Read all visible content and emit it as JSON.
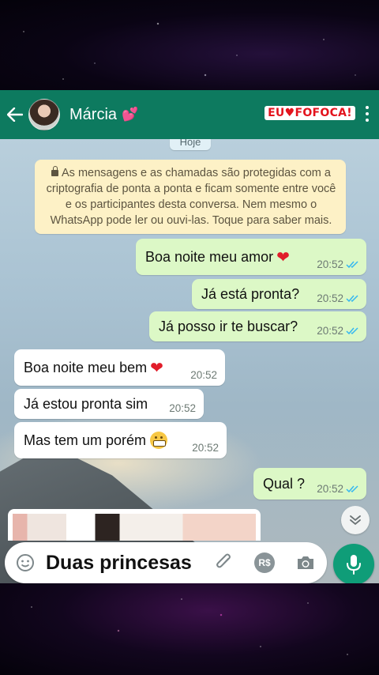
{
  "header": {
    "contact_name": "Márcia",
    "name_emoji": "💕",
    "brand_watermark": {
      "prefix": "EU",
      "heart": "♥",
      "suffix": "FOFOCA!"
    },
    "icons": [
      "back-arrow-icon",
      "menu-dots-icon"
    ]
  },
  "chat": {
    "date_divider": "Hoje",
    "encryption_notice": "As mensagens e as chamadas são protegidas com a criptografia de ponta a ponta e ficam somente entre você e os participantes desta conversa. Nem mesmo o WhatsApp pode ler ou ouvi-las. Toque para saber mais.",
    "messages": [
      {
        "direction": "out",
        "text": "Boa noite meu amor",
        "emoji": "❤",
        "time": "20:52",
        "read": true
      },
      {
        "direction": "out",
        "text": "Já está pronta?",
        "emoji": "",
        "time": "20:52",
        "read": true
      },
      {
        "direction": "out",
        "text": "Já posso ir te buscar?",
        "emoji": "",
        "time": "20:52",
        "read": true
      },
      {
        "direction": "in",
        "text": "Boa noite meu bem",
        "emoji": "❤",
        "time": "20:52"
      },
      {
        "direction": "in",
        "text": "Já estou pronta sim",
        "emoji": "",
        "time": "20:52"
      },
      {
        "direction": "in",
        "text": "Mas tem um porém",
        "emoji": "grimacing-face",
        "time": "20:52"
      },
      {
        "direction": "out",
        "text": "Qual ?",
        "emoji": "",
        "time": "20:52",
        "read": true
      }
    ]
  },
  "composer": {
    "text": "Duas princesas",
    "payment_label": "R$",
    "icons": [
      "emoji-icon",
      "attach-icon",
      "payment-icon",
      "camera-icon",
      "mic-icon"
    ]
  },
  "colors": {
    "header": "#0d7a5f",
    "outgoing_bubble": "#dcf8c6",
    "incoming_bubble": "#ffffff",
    "read_ticks": "#34b7f1",
    "mic_button": "#0f9d78",
    "notice_bg": "#fdf1c6"
  }
}
